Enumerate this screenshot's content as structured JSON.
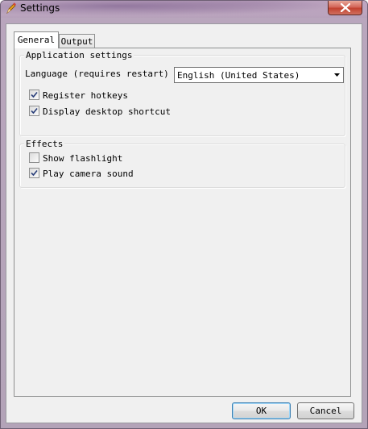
{
  "window": {
    "title": "Settings",
    "icon": "pencil-icon"
  },
  "tabs": [
    {
      "label": "General",
      "selected": true
    },
    {
      "label": "Output",
      "selected": false
    }
  ],
  "app_settings": {
    "legend": "Application settings",
    "language_label": "Language (requires restart)",
    "language_value": "English (United States)",
    "register_hotkeys": {
      "label": "Register hotkeys",
      "checked": true
    },
    "desktop_shortcut": {
      "label": "Display desktop shortcut",
      "checked": true
    }
  },
  "effects": {
    "legend": "Effects",
    "show_flashlight": {
      "label": "Show flashlight",
      "checked": false
    },
    "play_camera_sound": {
      "label": "Play camera sound",
      "checked": true
    }
  },
  "buttons": {
    "ok": "OK",
    "cancel": "Cancel"
  }
}
